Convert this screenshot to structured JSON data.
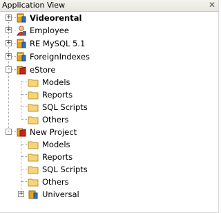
{
  "panel": {
    "title": "Application View",
    "close_glyph": "✕"
  },
  "tree": {
    "roots": [
      {
        "label": "Videorental",
        "icon": "database-icon",
        "toggle": "+"
      },
      {
        "label": "Employee",
        "icon": "person-icon",
        "toggle": "+"
      },
      {
        "label": "RE MySQL 5.1",
        "icon": "database-icon",
        "toggle": "+"
      },
      {
        "label": "ForeignIndexes",
        "icon": "database-icon",
        "toggle": "+"
      },
      {
        "label": "eStore",
        "icon": "project-icon",
        "toggle": "-",
        "children": [
          "Models",
          "Reports",
          "SQL Scripts",
          "Others"
        ]
      },
      {
        "label": "New Project",
        "icon": "project-icon",
        "toggle": "-",
        "children": [
          "Models",
          "Reports",
          "SQL Scripts",
          "Others"
        ],
        "extra_child": {
          "label": "Universal",
          "toggle": "+"
        }
      }
    ]
  }
}
